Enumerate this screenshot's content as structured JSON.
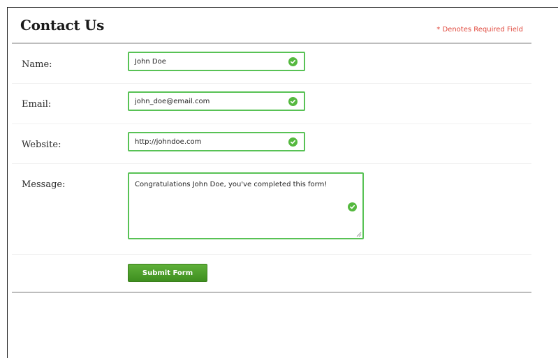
{
  "form": {
    "title": "Contact Us",
    "required_note": "* Denotes Required Field",
    "fields": {
      "name": {
        "label": "Name:",
        "value": "John Doe"
      },
      "email": {
        "label": "Email:",
        "value": "john_doe@email.com"
      },
      "website": {
        "label": "Website:",
        "value": "http://johndoe.com"
      },
      "message": {
        "label": "Message:",
        "value": "Congratulations John Doe, you've completed this form!"
      }
    },
    "submit_label": "Submit Form"
  },
  "colors": {
    "valid_border": "#58c255",
    "check": "#55b93f",
    "required_text": "#e0473b",
    "button": "#4a9e2a"
  },
  "icons": {
    "valid": "check-circle-icon",
    "resize": "resize-grip-icon"
  }
}
